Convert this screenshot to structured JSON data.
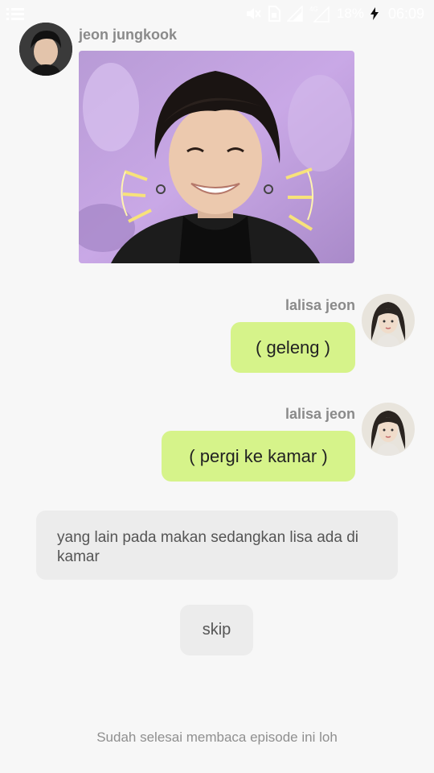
{
  "status_bar": {
    "battery_percent": "18%",
    "time": "06:09",
    "icons": [
      "menu-icon",
      "mute-icon",
      "sim-icon",
      "signal-icon",
      "4g-signal-icon",
      "battery-icon",
      "charging-icon"
    ]
  },
  "messages": [
    {
      "sender": "jeon jungkook",
      "side": "left",
      "type": "image"
    },
    {
      "sender": "lalisa jeon",
      "side": "right",
      "text": "( geleng )"
    },
    {
      "sender": "lalisa jeon",
      "side": "right",
      "text": "( pergi ke kamar )"
    }
  ],
  "narration": "yang lain pada makan sedangkan lisa ada di kamar",
  "skip_label": "skip",
  "footer": "Sudah selesai membaca episode ini loh",
  "colors": {
    "background": "#f7f7f7",
    "bubble_right": "#d6f38a",
    "narration_bg": "#ececec",
    "name_gray": "#8a8a8a"
  }
}
